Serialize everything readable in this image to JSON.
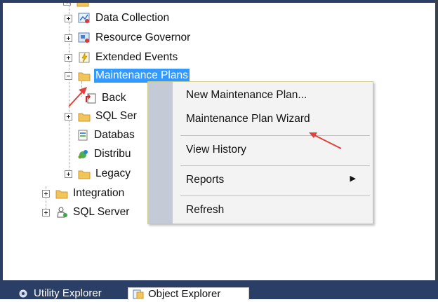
{
  "tree": {
    "items": [
      {
        "label": "Data Collection",
        "icon": "data-collection-icon",
        "expander": "plus"
      },
      {
        "label": "Resource Governor",
        "icon": "resource-governor-icon",
        "expander": "plus"
      },
      {
        "label": "Extended Events",
        "icon": "extended-events-icon",
        "expander": "plus"
      },
      {
        "label": "Maintenance Plans",
        "icon": "folder-icon",
        "expander": "minus",
        "selected": true
      },
      {
        "label": "Back",
        "icon": "maintenance-plan-icon"
      },
      {
        "label": "SQL Ser",
        "icon": "folder-icon",
        "expander": "plus"
      },
      {
        "label": "Databas",
        "icon": "database-mail-icon"
      },
      {
        "label": "Distribu",
        "icon": "distributed-transaction-icon"
      },
      {
        "label": "Legacy",
        "icon": "folder-icon",
        "expander": "plus"
      },
      {
        "label": "Integration",
        "icon": "folder-icon",
        "expander": "plus"
      },
      {
        "label": "SQL Server",
        "icon": "sql-server-agent-icon",
        "expander": "plus"
      }
    ]
  },
  "context_menu": {
    "items": [
      {
        "label": "New Maintenance Plan..."
      },
      {
        "label": "Maintenance Plan Wizard"
      },
      {
        "label": "View History"
      },
      {
        "label": "Reports",
        "has_submenu": true
      },
      {
        "label": "Refresh"
      }
    ]
  },
  "bottom_tabs": [
    {
      "label": "Utility Explorer",
      "icon": "utility-explorer-icon"
    },
    {
      "label": "Object Explorer",
      "icon": "object-explorer-icon"
    }
  ],
  "colors": {
    "selection": "#3399ff",
    "frame": "#2b3f66",
    "annotation_arrow": "#e0413a",
    "menu_gutter": "#c4cbd6"
  }
}
